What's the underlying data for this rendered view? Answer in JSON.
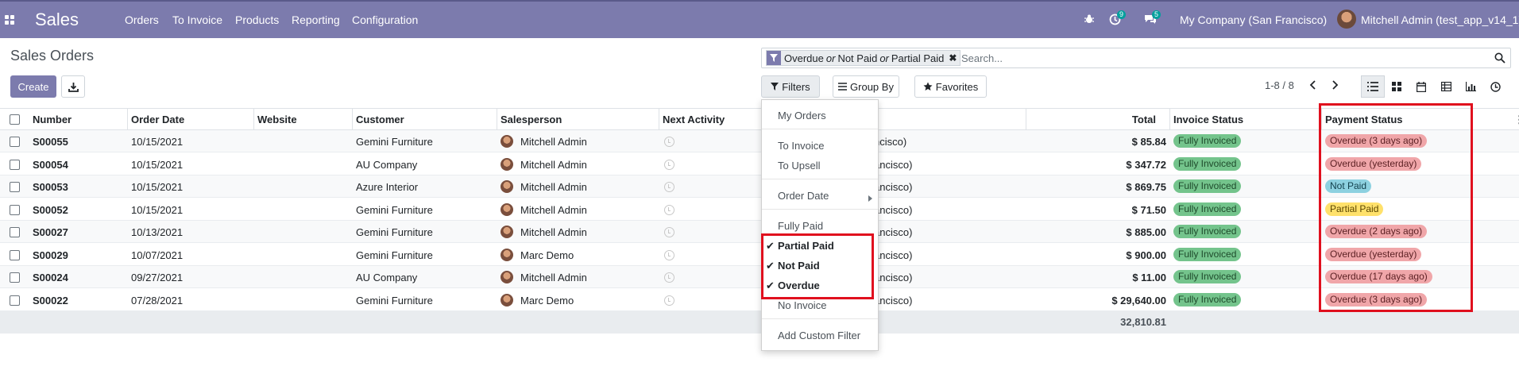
{
  "navbar": {
    "app_name": "Sales",
    "menu": [
      "Orders",
      "To Invoice",
      "Products",
      "Reporting",
      "Configuration"
    ],
    "activity_count": "9",
    "message_count": "5",
    "company": "My Company (San Francisco)",
    "user": "Mitchell Admin (test_app_v14_1)",
    "colors": {
      "bar": "#7c7bad",
      "badge": "#00a09d"
    }
  },
  "control_panel": {
    "title": "Sales Orders",
    "create_label": "Create",
    "search": {
      "facet_parts": [
        "Overdue",
        "or",
        "Not Paid",
        "or",
        "Partial Paid"
      ],
      "placeholder": "Search..."
    },
    "filters_label": "Filters",
    "group_by_label": "Group By",
    "favorites_label": "Favorites",
    "pager": "1-8 / 8"
  },
  "table": {
    "columns": [
      "Number",
      "Order Date",
      "Website",
      "Customer",
      "Salesperson",
      "Next Activity",
      "Total",
      "Invoice Status",
      "Payment Status"
    ],
    "rows": [
      {
        "number": "S00055",
        "date": "10/15/2021",
        "customer": "Gemini Furniture",
        "salesperson": "Mitchell Admin",
        "company_tail": "ncisco)",
        "total": "$ 85.84",
        "invoice_status": "Fully Invoiced",
        "payment_status": "Overdue (3 days ago)",
        "payment_color": "red"
      },
      {
        "number": "S00054",
        "date": "10/15/2021",
        "customer": "AU Company",
        "salesperson": "Mitchell Admin",
        "company_tail": "ancisco)",
        "total": "$ 347.72",
        "invoice_status": "Fully Invoiced",
        "payment_status": "Overdue (yesterday)",
        "payment_color": "red"
      },
      {
        "number": "S00053",
        "date": "10/15/2021",
        "customer": "Azure Interior",
        "salesperson": "Mitchell Admin",
        "company_tail": "ancisco)",
        "total": "$ 869.75",
        "invoice_status": "Fully Invoiced",
        "payment_status": "Not Paid",
        "payment_color": "blue"
      },
      {
        "number": "S00052",
        "date": "10/15/2021",
        "customer": "Gemini Furniture",
        "salesperson": "Mitchell Admin",
        "company_tail": "ancisco)",
        "total": "$ 71.50",
        "invoice_status": "Fully Invoiced",
        "payment_status": "Partial Paid",
        "payment_color": "yellow"
      },
      {
        "number": "S00027",
        "date": "10/13/2021",
        "customer": "Gemini Furniture",
        "salesperson": "Mitchell Admin",
        "company_tail": "ancisco)",
        "total": "$ 885.00",
        "invoice_status": "Fully Invoiced",
        "payment_status": "Overdue (2 days ago)",
        "payment_color": "red"
      },
      {
        "number": "S00029",
        "date": "10/07/2021",
        "customer": "Gemini Furniture",
        "salesperson": "Marc Demo",
        "company_tail": "ancisco)",
        "total": "$ 900.00",
        "invoice_status": "Fully Invoiced",
        "payment_status": "Overdue (yesterday)",
        "payment_color": "red"
      },
      {
        "number": "S00024",
        "date": "09/27/2021",
        "customer": "AU Company",
        "salesperson": "Mitchell Admin",
        "company_tail": "ancisco)",
        "total": "$ 11.00",
        "invoice_status": "Fully Invoiced",
        "payment_status": "Overdue (17 days ago)",
        "payment_color": "red"
      },
      {
        "number": "S00022",
        "date": "07/28/2021",
        "customer": "Gemini Furniture",
        "salesperson": "Marc Demo",
        "company_tail": "ancisco)",
        "total": "$ 29,640.00",
        "invoice_status": "Fully Invoiced",
        "payment_status": "Overdue (3 days ago)",
        "payment_color": "red"
      }
    ],
    "grand_total": "32,810.81"
  },
  "filters_menu": {
    "items": [
      {
        "label": "My Orders",
        "checked": false
      },
      {
        "label": "To Invoice",
        "checked": false
      },
      {
        "label": "To Upsell",
        "checked": false
      },
      {
        "label": "Order Date",
        "checked": false
      },
      {
        "label": "Fully Paid",
        "checked": false
      },
      {
        "label": "Partial Paid",
        "checked": true
      },
      {
        "label": "Not Paid",
        "checked": true
      },
      {
        "label": "Overdue",
        "checked": true
      },
      {
        "label": "No Invoice",
        "checked": false
      },
      {
        "label": "Add Custom Filter",
        "checked": false
      }
    ]
  },
  "highlight_color": "#e0101e"
}
